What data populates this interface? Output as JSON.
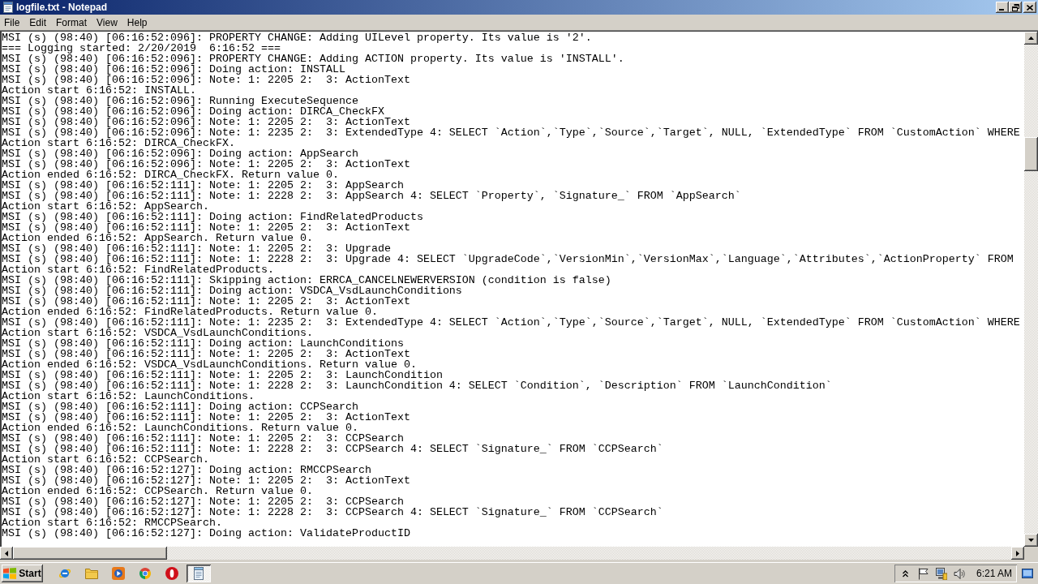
{
  "window": {
    "title": "logfile.txt - Notepad"
  },
  "menu": [
    "File",
    "Edit",
    "Format",
    "View",
    "Help"
  ],
  "document": {
    "lines": [
      "MSI (s) (98:40) [06:16:52:096]: PROPERTY CHANGE: Adding UILevel property. Its value is '2'.",
      "=== Logging started: 2/20/2019  6:16:52 ===",
      "MSI (s) (98:40) [06:16:52:096]: PROPERTY CHANGE: Adding ACTION property. Its value is 'INSTALL'.",
      "MSI (s) (98:40) [06:16:52:096]: Doing action: INSTALL",
      "MSI (s) (98:40) [06:16:52:096]: Note: 1: 2205 2:  3: ActionText",
      "Action start 6:16:52: INSTALL.",
      "MSI (s) (98:40) [06:16:52:096]: Running ExecuteSequence",
      "MSI (s) (98:40) [06:16:52:096]: Doing action: DIRCA_CheckFX",
      "MSI (s) (98:40) [06:16:52:096]: Note: 1: 2205 2:  3: ActionText",
      "MSI (s) (98:40) [06:16:52:096]: Note: 1: 2235 2:  3: ExtendedType 4: SELECT `Action`,`Type`,`Source`,`Target`, NULL, `ExtendedType` FROM `CustomAction` WHERE",
      "Action start 6:16:52: DIRCA_CheckFX.",
      "MSI (s) (98:40) [06:16:52:096]: Doing action: AppSearch",
      "MSI (s) (98:40) [06:16:52:096]: Note: 1: 2205 2:  3: ActionText",
      "Action ended 6:16:52: DIRCA_CheckFX. Return value 0.",
      "MSI (s) (98:40) [06:16:52:111]: Note: 1: 2205 2:  3: AppSearch",
      "MSI (s) (98:40) [06:16:52:111]: Note: 1: 2228 2:  3: AppSearch 4: SELECT `Property`, `Signature_` FROM `AppSearch`",
      "Action start 6:16:52: AppSearch.",
      "MSI (s) (98:40) [06:16:52:111]: Doing action: FindRelatedProducts",
      "MSI (s) (98:40) [06:16:52:111]: Note: 1: 2205 2:  3: ActionText",
      "Action ended 6:16:52: AppSearch. Return value 0.",
      "MSI (s) (98:40) [06:16:52:111]: Note: 1: 2205 2:  3: Upgrade",
      "MSI (s) (98:40) [06:16:52:111]: Note: 1: 2228 2:  3: Upgrade 4: SELECT `UpgradeCode`,`VersionMin`,`VersionMax`,`Language`,`Attributes`,`ActionProperty` FROM",
      "Action start 6:16:52: FindRelatedProducts.",
      "MSI (s) (98:40) [06:16:52:111]: Skipping action: ERRCA_CANCELNEWERVERSION (condition is false)",
      "MSI (s) (98:40) [06:16:52:111]: Doing action: VSDCA_VsdLaunchConditions",
      "MSI (s) (98:40) [06:16:52:111]: Note: 1: 2205 2:  3: ActionText",
      "Action ended 6:16:52: FindRelatedProducts. Return value 0.",
      "MSI (s) (98:40) [06:16:52:111]: Note: 1: 2235 2:  3: ExtendedType 4: SELECT `Action`,`Type`,`Source`,`Target`, NULL, `ExtendedType` FROM `CustomAction` WHERE",
      "Action start 6:16:52: VSDCA_VsdLaunchConditions.",
      "MSI (s) (98:40) [06:16:52:111]: Doing action: LaunchConditions",
      "MSI (s) (98:40) [06:16:52:111]: Note: 1: 2205 2:  3: ActionText",
      "Action ended 6:16:52: VSDCA_VsdLaunchConditions. Return value 0.",
      "MSI (s) (98:40) [06:16:52:111]: Note: 1: 2205 2:  3: LaunchCondition",
      "MSI (s) (98:40) [06:16:52:111]: Note: 1: 2228 2:  3: LaunchCondition 4: SELECT `Condition`, `Description` FROM `LaunchCondition`",
      "Action start 6:16:52: LaunchConditions.",
      "MSI (s) (98:40) [06:16:52:111]: Doing action: CCPSearch",
      "MSI (s) (98:40) [06:16:52:111]: Note: 1: 2205 2:  3: ActionText",
      "Action ended 6:16:52: LaunchConditions. Return value 0.",
      "MSI (s) (98:40) [06:16:52:111]: Note: 1: 2205 2:  3: CCPSearch",
      "MSI (s) (98:40) [06:16:52:111]: Note: 1: 2228 2:  3: CCPSearch 4: SELECT `Signature_` FROM `CCPSearch`",
      "Action start 6:16:52: CCPSearch.",
      "MSI (s) (98:40) [06:16:52:127]: Doing action: RMCCPSearch",
      "MSI (s) (98:40) [06:16:52:127]: Note: 1: 2205 2:  3: ActionText",
      "Action ended 6:16:52: CCPSearch. Return value 0.",
      "MSI (s) (98:40) [06:16:52:127]: Note: 1: 2205 2:  3: CCPSearch",
      "MSI (s) (98:40) [06:16:52:127]: Note: 1: 2228 2:  3: CCPSearch 4: SELECT `Signature_` FROM `CCPSearch`",
      "Action start 6:16:52: RMCCPSearch.",
      "MSI (s) (98:40) [06:16:52:127]: Doing action: ValidateProductID"
    ]
  },
  "taskbar": {
    "start": "Start",
    "apps": [
      {
        "kind": "browser",
        "selected": false
      },
      {
        "kind": "folder",
        "selected": false
      },
      {
        "kind": "media",
        "selected": false
      },
      {
        "kind": "chrome",
        "selected": false
      },
      {
        "kind": "oval",
        "selected": false
      },
      {
        "kind": "notepad",
        "selected": true
      }
    ],
    "clock": "6:21 AM"
  }
}
